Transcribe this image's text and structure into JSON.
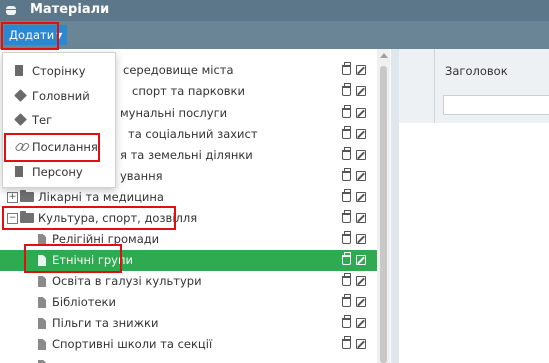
{
  "window": {
    "title": "Матеріали"
  },
  "toolbar": {
    "add_label": "Додати"
  },
  "add_menu": {
    "items": [
      {
        "label": "Сторінку",
        "icon": "document-icon"
      },
      {
        "label": "Головний",
        "icon": "tag-icon"
      },
      {
        "label": "Тег",
        "icon": "tag-icon"
      },
      {
        "label": "Посилання",
        "icon": "link-icon"
      },
      {
        "label": "Персону",
        "icon": "document-icon"
      }
    ]
  },
  "tree": {
    "rows": [
      {
        "label": "середовище міста"
      },
      {
        "label": "спорт та парковки"
      },
      {
        "label": "мунальні послуги"
      },
      {
        "label": "та соціальний захист"
      },
      {
        "label": "я та земельні ділянки"
      },
      {
        "label": "ування"
      },
      {
        "label": "Лікарні та медицина"
      },
      {
        "label": "Культура, спорт, дозвілля"
      },
      {
        "label": "Релігійні громади"
      },
      {
        "label": "Етнічні групи",
        "selected": true
      },
      {
        "label": "Освіта в галузі культури"
      },
      {
        "label": "Бібліотеки"
      },
      {
        "label": "Пільги та знижки"
      },
      {
        "label": "Спортивні школи та секції"
      }
    ]
  },
  "right_panel": {
    "column_header": "Заголовок",
    "filter_value": ""
  },
  "colors": {
    "titlebar": "#5c7789",
    "toolbar": "#6a8596",
    "primary_button": "#2a87d0",
    "selected_row": "#2eaa50",
    "highlight": "#e01010"
  }
}
